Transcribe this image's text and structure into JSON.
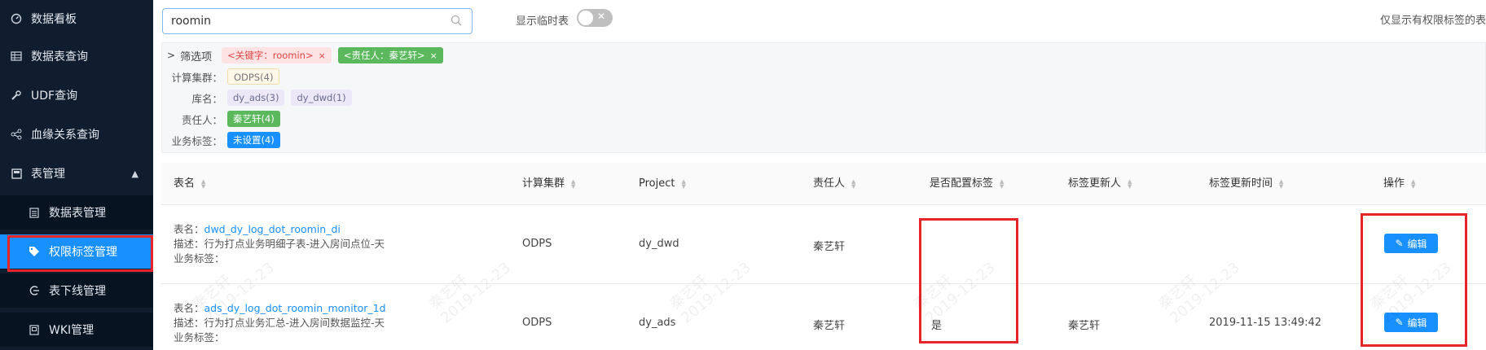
{
  "sidebar": {
    "items": [
      {
        "label": "数据看板",
        "icon": "dashboard-icon"
      },
      {
        "label": "数据表查询",
        "icon": "table-icon"
      },
      {
        "label": "UDF查询",
        "icon": "wrench-icon"
      },
      {
        "label": "血缘关系查询",
        "icon": "share-icon"
      },
      {
        "label": "表管理",
        "icon": "folder-icon"
      },
      {
        "label": "数据表管理",
        "icon": "list-icon"
      },
      {
        "label": "权限标签管理",
        "icon": "tag-icon"
      },
      {
        "label": "表下线管理",
        "icon": "offline-icon"
      },
      {
        "label": "WKI管理",
        "icon": "doc-icon"
      }
    ],
    "active_item": "权限标签管理"
  },
  "search": {
    "value": "roomin",
    "placeholder": ""
  },
  "toggle": {
    "label": "显示临时表",
    "state": "off"
  },
  "right_note": "仅显示有权限标签的表",
  "filters": {
    "title": "筛选项",
    "active_chips": [
      {
        "label": "<关键字：roomin>",
        "close": "×"
      },
      {
        "label": "<责任人：秦艺轩>",
        "close": "×"
      }
    ],
    "rows": [
      {
        "label": "计算集群：",
        "chips": [
          "ODPS(4)"
        ]
      },
      {
        "label": "库名：",
        "chips": [
          "dy_ads(3)",
          "dy_dwd(1)"
        ]
      },
      {
        "label": "责任人：",
        "chips": [
          "秦艺轩(4)"
        ]
      },
      {
        "label": "业务标签：",
        "chips": [
          "未设置(4)"
        ]
      }
    ]
  },
  "table": {
    "columns": [
      "表名",
      "计算集群",
      "Project",
      "责任人",
      "是否配置标签",
      "标签更新人",
      "标签更新时间",
      "操作"
    ],
    "name_prefix": "表名：",
    "desc_prefix": "描述：",
    "tag_prefix": "业务标签：",
    "rows": [
      {
        "name": "dwd_dy_log_dot_roomin_di",
        "desc": "行为打点业务明细子表-进入房间点位-天",
        "cluster": "ODPS",
        "project": "dy_dwd",
        "owner": "秦艺轩",
        "configured": "",
        "updater": "",
        "updated_at": "",
        "action": "编辑"
      },
      {
        "name": "ads_dy_log_dot_roomin_monitor_1d",
        "desc": "行为打点业务汇总-进入房间数据监控-天",
        "cluster": "ODPS",
        "project": "dy_ads",
        "owner": "秦艺轩",
        "configured": "是",
        "updater": "秦艺轩",
        "updated_at": "2019-11-15 13:49:42",
        "action": "编辑"
      }
    ]
  },
  "watermark": {
    "name": "秦艺轩",
    "date": "2019-12-23"
  },
  "colors": {
    "accent": "#1890ff",
    "sidebar": "#0f1d2e",
    "highlight_box": "#e8242b",
    "owner_chip": "#5bb85d"
  }
}
